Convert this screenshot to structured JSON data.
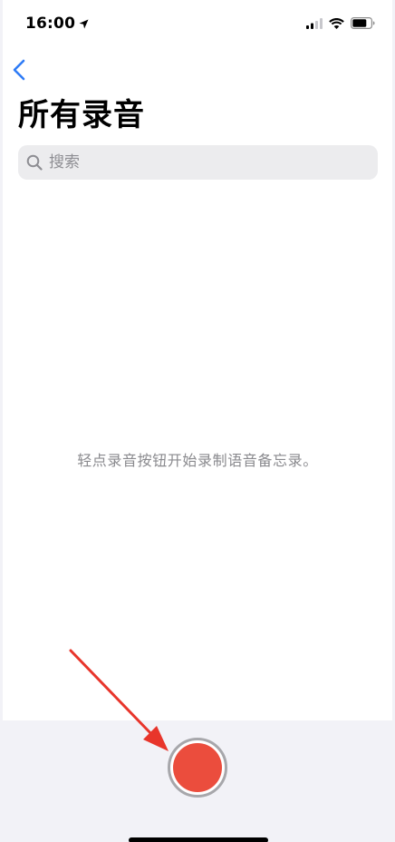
{
  "status_bar": {
    "time": "16:00",
    "icons": [
      "location-arrow-icon",
      "cellular-signal-icon",
      "wifi-icon",
      "battery-icon"
    ]
  },
  "nav": {
    "back_icon": "chevron-left-icon"
  },
  "page": {
    "title": "所有录音"
  },
  "search": {
    "icon": "search-icon",
    "placeholder": "搜索",
    "value": ""
  },
  "empty_state": {
    "message": "轻点录音按钮开始录制语音备忘录。"
  },
  "record": {
    "icon": "record-button",
    "color": "#eb4d3d"
  },
  "annotation": {
    "type": "red-arrow",
    "color": "#e8352b"
  },
  "colors": {
    "accent": "#2f7cf6",
    "background": "#ffffff",
    "panel": "#f2f2f7"
  }
}
